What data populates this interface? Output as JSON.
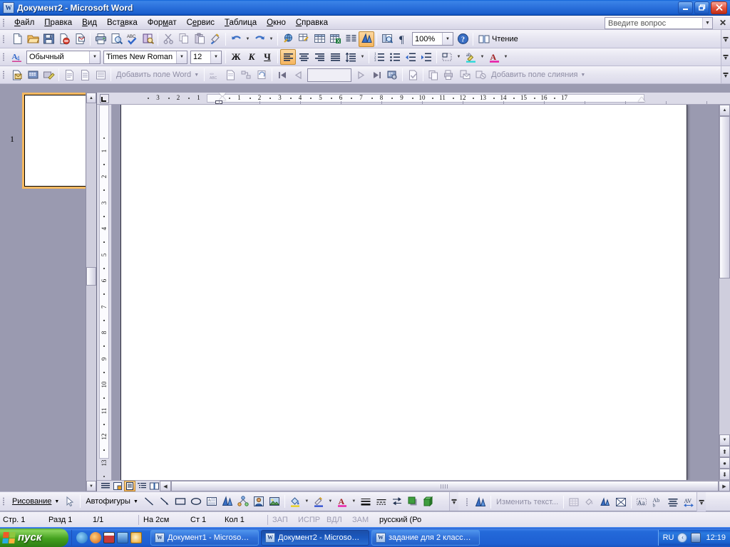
{
  "window": {
    "title": "Документ2 - Microsoft Word",
    "app_icon": "word-document-icon",
    "minimize": "_",
    "restore": "❐",
    "close": "✕"
  },
  "menu": {
    "items": [
      {
        "label": "Файл",
        "accel": "Ф"
      },
      {
        "label": "Правка",
        "accel": "П"
      },
      {
        "label": "Вид",
        "accel": "В"
      },
      {
        "label": "Вставка",
        "accel": "а"
      },
      {
        "label": "Формат",
        "accel": "м"
      },
      {
        "label": "Сервис",
        "accel": "е"
      },
      {
        "label": "Таблица",
        "accel": "Т"
      },
      {
        "label": "Окно",
        "accel": "О"
      },
      {
        "label": "Справка",
        "accel": "С"
      }
    ],
    "ask_placeholder": "Введите вопрос",
    "close_label": "✕"
  },
  "standard_toolbar": {
    "buttons": [
      {
        "name": "new-document-icon",
        "tip": "Создать"
      },
      {
        "name": "open-folder-icon",
        "tip": "Открыть"
      },
      {
        "name": "save-icon",
        "tip": "Сохранить"
      },
      {
        "name": "permission-icon",
        "tip": "Разрешения"
      },
      {
        "name": "email-icon",
        "tip": "Сообщение"
      },
      {
        "name": "print-icon",
        "tip": "Печать"
      },
      {
        "name": "print-preview-icon",
        "tip": "Предварительный просмотр"
      },
      {
        "name": "spellcheck-icon",
        "tip": "Правописание"
      },
      {
        "name": "research-icon",
        "tip": "Справочные материалы"
      },
      {
        "name": "cut-scissors-icon",
        "tip": "Вырезать"
      },
      {
        "name": "copy-icon",
        "tip": "Копировать"
      },
      {
        "name": "paste-icon",
        "tip": "Вставить"
      },
      {
        "name": "format-painter-icon",
        "tip": "Формат по образцу"
      },
      {
        "name": "undo-icon",
        "tip": "Отменить"
      },
      {
        "name": "redo-icon",
        "tip": "Вернуть"
      },
      {
        "name": "hyperlink-icon",
        "tip": "Гиперссылка"
      },
      {
        "name": "tables-borders-icon",
        "tip": "Таблицы и границы"
      },
      {
        "name": "insert-table-icon",
        "tip": "Вставить таблицу"
      },
      {
        "name": "insert-excel-sheet-icon",
        "tip": "Вставить лист Excel"
      },
      {
        "name": "columns-icon",
        "tip": "Колонки"
      },
      {
        "name": "drawing-icon",
        "tip": "Рисование"
      },
      {
        "name": "document-map-icon",
        "tip": "Схема документа"
      },
      {
        "name": "show-formatting-marks-icon",
        "tip": "Непечатаемые знаки"
      }
    ],
    "zoom_value": "100%",
    "help_icon": "help-question-icon",
    "reading_label": "Чтение",
    "reading_icon": "reading-book-icon",
    "overflow": "toolbar-options"
  },
  "formatting_toolbar": {
    "styles_icon": "styles-formatting-icon",
    "style_value": "Обычный",
    "font_value": "Times New Roman",
    "size_value": "12",
    "bold_label": "Ж",
    "italic_label": "К",
    "underline_label": "Ч",
    "align_left": "align-left-icon",
    "align_center": "align-center-icon",
    "align_right": "align-right-icon",
    "align_justify": "align-justify-icon",
    "line_spacing": "line-spacing-icon",
    "numbered_list": "numbered-list-icon",
    "bulleted_list": "bulleted-list-icon",
    "decrease_indent": "decrease-indent-icon",
    "increase_indent": "increase-indent-icon",
    "borders": "borders-icon",
    "highlight": "highlight-color-icon",
    "font_color": "font-color-icon",
    "active_align": "align-left",
    "overflow": "toolbar-options"
  },
  "mailmerge_toolbar": {
    "setup_icon": "mailmerge-setup-icon",
    "open_source_icon": "open-data-source-icon",
    "recipients_icon": "edit-recipients-icon",
    "address_block_icon": "address-block-icon",
    "greeting_line_icon": "greeting-line-icon",
    "insert_field_icon": "insert-field-icon",
    "add_word_field_label": "Добавить поле Word",
    "view_merged_icon": "view-merged-data-icon",
    "highlight_fields_icon": "highlight-merge-fields-icon",
    "match_fields_icon": "match-fields-icon",
    "update_labels_icon": "update-labels-icon",
    "first_record": "first-record-icon",
    "prev_record": "previous-record-icon",
    "record_value": "",
    "next_record": "next-record-icon",
    "last_record": "last-record-icon",
    "find_entry_icon": "find-entry-icon",
    "check_errors_icon": "check-errors-icon",
    "merge_to_new_icon": "merge-to-new-document-icon",
    "merge_to_printer_icon": "merge-to-printer-icon",
    "merge_to_email_icon": "merge-to-email-icon",
    "merge_to_fax_icon": "merge-to-fax-icon",
    "add_merge_field_label": "Добавить поле слияния",
    "overflow": "toolbar-options"
  },
  "thumbnails": {
    "page_number": "1",
    "selected_page": 1
  },
  "ruler": {
    "horizontal_labels": [
      "3",
      "2",
      "1",
      "1",
      "2",
      "3",
      "4",
      "5",
      "6",
      "7",
      "8",
      "9",
      "10",
      "11",
      "12",
      "13",
      "14",
      "15",
      "16",
      "17"
    ],
    "vertical_labels": [
      "1",
      "2",
      "3",
      "4",
      "5",
      "6",
      "7",
      "8",
      "9",
      "10",
      "11",
      "12",
      "13"
    ],
    "tab_selector": "left-tab-stop-icon"
  },
  "view_buttons": [
    {
      "name": "view-normal",
      "label": "Обычный"
    },
    {
      "name": "view-web",
      "label": "Веб-документ"
    },
    {
      "name": "view-print",
      "label": "Разметка страницы"
    },
    {
      "name": "view-outline",
      "label": "Структура"
    },
    {
      "name": "view-reading",
      "label": "Чтение"
    }
  ],
  "view_active": "view-print",
  "drawing_toolbar": {
    "menu_label": "Рисование",
    "select_icon": "select-objects-icon",
    "autoshapes_label": "Автофигуры",
    "line_icon": "line-icon",
    "arrow_icon": "arrow-icon",
    "rectangle_icon": "rectangle-icon",
    "oval_icon": "oval-icon",
    "textbox_icon": "text-box-icon",
    "wordart_icon": "insert-wordart-icon",
    "diagram_icon": "insert-diagram-icon",
    "clipart_icon": "insert-clip-art-icon",
    "picture_icon": "insert-picture-icon",
    "fill_color_icon": "fill-color-icon",
    "line_color_icon": "line-color-icon",
    "font_color_icon": "font-color-icon",
    "line_style_icon": "line-style-icon",
    "dash_style_icon": "dash-style-icon",
    "arrow_style_icon": "arrow-style-icon",
    "shadow_style_icon": "shadow-style-icon",
    "3d_style_icon": "3d-style-icon",
    "overflow": "toolbar-options"
  },
  "wordart_toolbar": {
    "insert_icon": "insert-wordart-icon",
    "edit_text_label": "Изменить текст...",
    "gallery_icon": "wordart-gallery-icon",
    "format_icon": "format-wordart-icon",
    "shape_icon": "wordart-shape-icon",
    "text_wrap_icon": "text-wrapping-icon",
    "same_height_icon": "wordart-same-letter-heights-icon",
    "vertical_text_icon": "wordart-vertical-text-icon",
    "alignment_icon": "wordart-alignment-icon",
    "char_spacing_icon": "wordart-character-spacing-icon",
    "overflow": "toolbar-options"
  },
  "statusbar": {
    "page": "Стр. 1",
    "section": "Разд 1",
    "pages": "1/1",
    "at": "На 2см",
    "line": "Ст 1",
    "column": "Кол 1",
    "rec": "ЗАП",
    "trk": "ИСПР",
    "ext": "ВДЛ",
    "ovr": "ЗАМ",
    "language": "русский (Ро"
  },
  "taskbar": {
    "start_label": "пуск",
    "quick_launch": [
      {
        "name": "internet-explorer-icon",
        "color": "#2b72c8"
      },
      {
        "name": "media-player-icon",
        "color": "#d86a18"
      },
      {
        "name": "xp-calendar-icon",
        "color": "#c43a3a"
      },
      {
        "name": "show-desktop-icon",
        "color": "#2f6fc0"
      },
      {
        "name": "clock-icon",
        "color": "#e8a020"
      }
    ],
    "tasks": [
      {
        "label": "Документ1 - Microso…",
        "active": false
      },
      {
        "label": "Документ2 - Microso…",
        "active": true
      },
      {
        "label": "задание для 2 класс…",
        "active": false
      }
    ],
    "tray_language": "RU",
    "tray_icons": [
      "show-hidden-icons",
      "network-icon"
    ],
    "clock": "12:19"
  },
  "colors": {
    "titlebar_blue": "#1c61cf",
    "accent_orange": "#f6b55e",
    "desk_gray": "#9a9ab0",
    "toolbar_bg": "#e7e6f1"
  }
}
